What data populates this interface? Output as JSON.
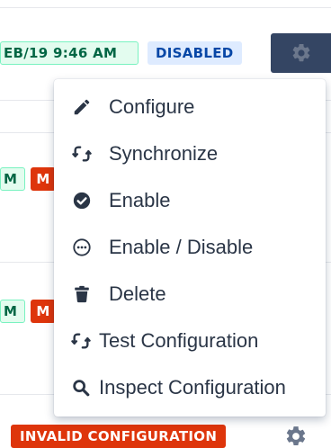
{
  "table": {
    "row1": {
      "date_label": "EB/19 9:46 AM",
      "status_label": "DISABLED"
    },
    "row2": {
      "date_fragment": "M",
      "status_fragment": "M"
    },
    "row3": {
      "date_fragment": "M",
      "status_fragment": "M"
    },
    "row4": {
      "status_label": "INVALID CONFIGURATION"
    }
  },
  "menu": {
    "items": [
      {
        "label": "Configure",
        "icon": "pencil-icon"
      },
      {
        "label": "Synchronize",
        "icon": "sync-icon"
      },
      {
        "label": "Enable",
        "icon": "check-circle-icon"
      },
      {
        "label": "Enable / Disable",
        "icon": "ellipsis-circle-icon"
      },
      {
        "label": "Delete",
        "icon": "trash-icon"
      },
      {
        "label": "Test Configuration",
        "icon": "sync-icon"
      },
      {
        "label": "Inspect Configuration",
        "icon": "search-icon"
      }
    ]
  },
  "colors": {
    "menu_text": "#2a3546",
    "date_lozenge_bg": "#e3fcef",
    "date_lozenge_text": "#006644",
    "disabled_lozenge_bg": "#deebff",
    "disabled_lozenge_text": "#0747a6",
    "error_lozenge_bg": "#de350b",
    "gear_button_bg": "#344563"
  }
}
